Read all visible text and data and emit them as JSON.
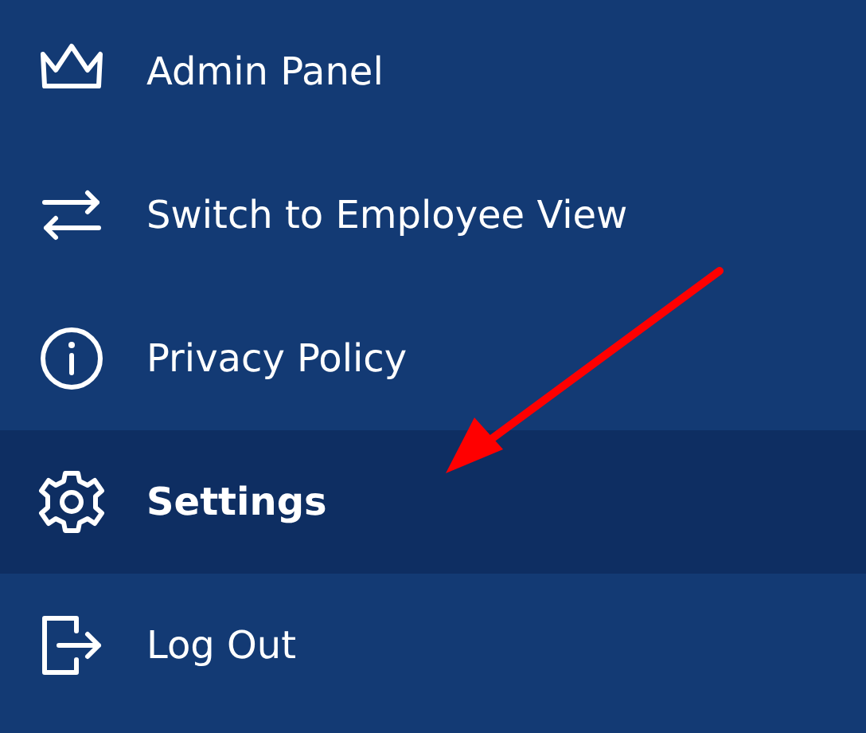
{
  "menu": {
    "items": [
      {
        "label": "Admin Panel",
        "kind": "admin",
        "selected": false
      },
      {
        "label": "Switch to Employee View",
        "kind": "switch",
        "selected": false
      },
      {
        "label": "Privacy Policy",
        "kind": "info",
        "selected": false
      },
      {
        "label": "Settings",
        "kind": "settings",
        "selected": true
      },
      {
        "label": "Log Out",
        "kind": "logout",
        "selected": false
      }
    ]
  }
}
